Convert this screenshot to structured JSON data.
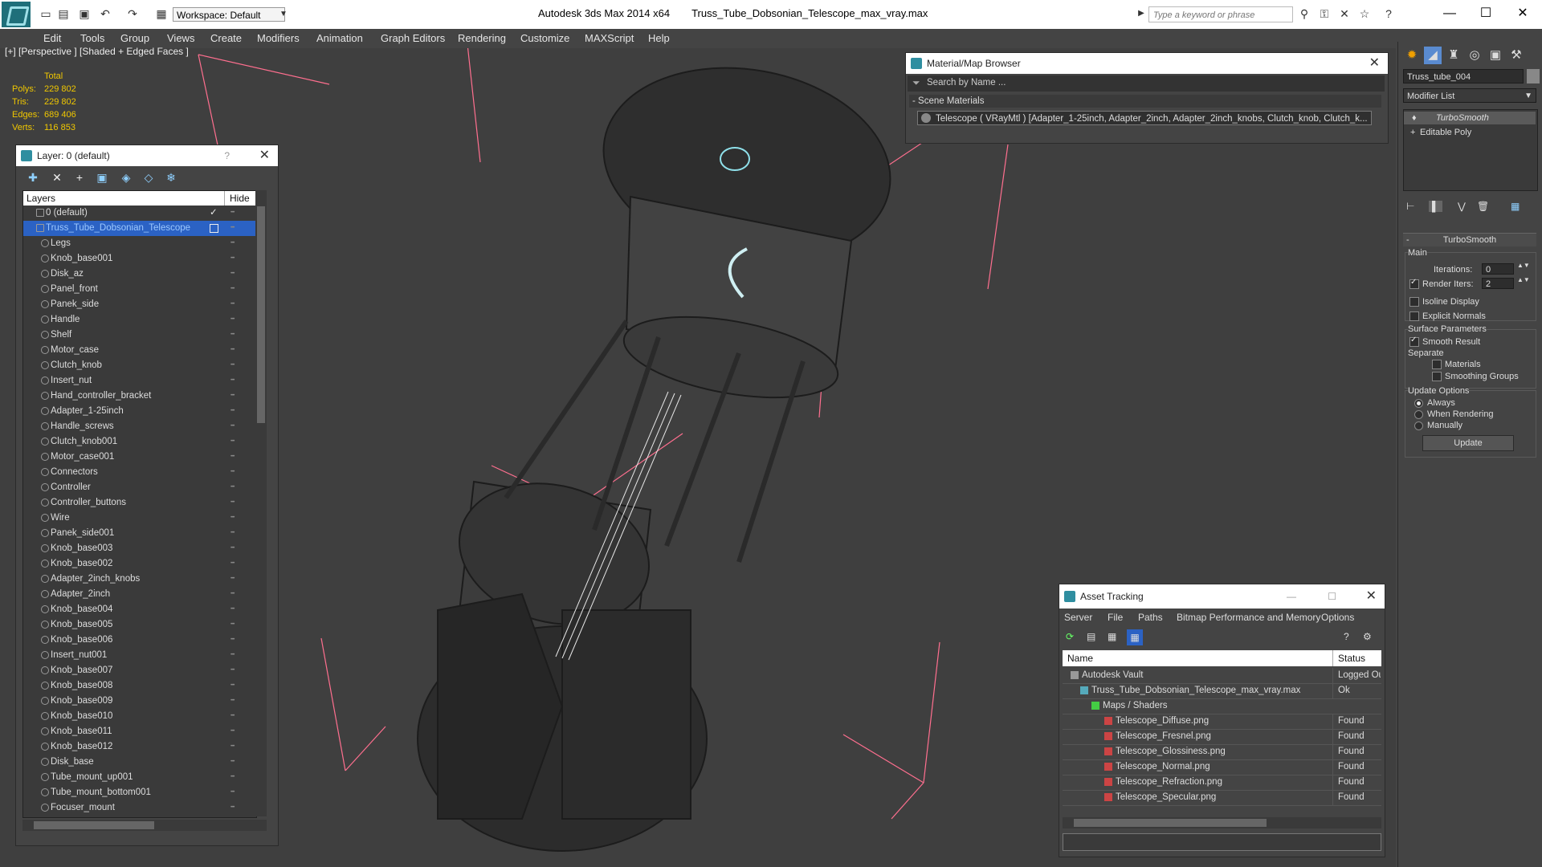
{
  "titlebar": {
    "workspace_label": "Workspace: Default",
    "app_name": "Autodesk 3ds Max  2014 x64",
    "file_name": "Truss_Tube_Dobsonian_Telescope_max_vray.max",
    "search_placeholder": "Type a keyword or phrase"
  },
  "menu": [
    "Edit",
    "Tools",
    "Group",
    "Views",
    "Create",
    "Modifiers",
    "Animation",
    "Graph Editors",
    "Rendering",
    "Customize",
    "MAXScript",
    "Help"
  ],
  "viewport": {
    "label": "[+] [Perspective ] [Shaded + Edged Faces ]",
    "stats": {
      "total_label": "Total",
      "polys_label": "Polys:",
      "polys": "229 802",
      "tris_label": "Tris:",
      "tris": "229 802",
      "edges_label": "Edges:",
      "edges": "689 406",
      "verts_label": "Verts:",
      "verts": "116 853"
    }
  },
  "layer_panel": {
    "title": "Layer: 0 (default)",
    "help": "?",
    "col_layers": "Layers",
    "col_hide": "Hide",
    "rows": [
      "0 (default)",
      "Truss_Tube_Dobsonian_Telescope",
      "Legs",
      "Knob_base001",
      "Disk_az",
      "Panel_front",
      "Panek_side",
      "Handle",
      "Shelf",
      "Motor_case",
      "Clutch_knob",
      "Insert_nut",
      "Hand_controller_bracket",
      "Adapter_1-25inch",
      "Handle_screws",
      "Clutch_knob001",
      "Motor_case001",
      "Connectors",
      "Controller",
      "Controller_buttons",
      "Wire",
      "Panek_side001",
      "Knob_base003",
      "Knob_base002",
      "Adapter_2inch_knobs",
      "Adapter_2inch",
      "Knob_base004",
      "Knob_base005",
      "Knob_base006",
      "Insert_nut001",
      "Knob_base007",
      "Knob_base008",
      "Knob_base009",
      "Knob_base010",
      "Knob_base011",
      "Knob_base012",
      "Disk_base",
      "Tube_mount_up001",
      "Tube_mount_bottom001",
      "Focuser_mount"
    ]
  },
  "material_browser": {
    "title": "Material/Map Browser",
    "search_placeholder": "Search by Name ...",
    "section": "- Scene Materials",
    "item": "Telescope  ( VRayMtl )  [Adapter_1-25inch, Adapter_2inch, Adapter_2inch_knobs, Clutch_knob, Clutch_k..."
  },
  "asset_tracking": {
    "title": "Asset Tracking",
    "menu": [
      "Server",
      "File",
      "Paths",
      "Bitmap Performance and Memory",
      "Options"
    ],
    "col_name": "Name",
    "col_status": "Status",
    "rows": [
      {
        "name": "Autodesk Vault",
        "status": "Logged Ou"
      },
      {
        "name": "Truss_Tube_Dobsonian_Telescope_max_vray.max",
        "status": "Ok"
      },
      {
        "name": "Maps / Shaders",
        "status": ""
      },
      {
        "name": "Telescope_Diffuse.png",
        "status": "Found"
      },
      {
        "name": "Telescope_Fresnel.png",
        "status": "Found"
      },
      {
        "name": "Telescope_Glossiness.png",
        "status": "Found"
      },
      {
        "name": "Telescope_Normal.png",
        "status": "Found"
      },
      {
        "name": "Telescope_Refraction.png",
        "status": "Found"
      },
      {
        "name": "Telescope_Specular.png",
        "status": "Found"
      }
    ]
  },
  "command_panel": {
    "object_name": "Truss_tube_004",
    "modifier_list": "Modifier List",
    "stack": [
      "TurboSmooth",
      "Editable Poly"
    ],
    "rollout_title": "TurboSmooth",
    "main_label": "Main",
    "iterations_label": "Iterations:",
    "iterations_value": "0",
    "render_iters_label": "Render Iters:",
    "render_iters_value": "2",
    "isoline_label": "Isoline Display",
    "explicit_normals_label": "Explicit Normals",
    "surface_params_label": "Surface Parameters",
    "smooth_result_label": "Smooth Result",
    "separate_label": "Separate",
    "materials_label": "Materials",
    "smoothing_groups_label": "Smoothing Groups",
    "update_options_label": "Update Options",
    "always_label": "Always",
    "when_rendering_label": "When Rendering",
    "manually_label": "Manually",
    "update_button": "Update"
  },
  "colors": {
    "accent": "#2b62c4",
    "viewport_bg": "#3f3f3f",
    "stats": "#f0c700"
  }
}
